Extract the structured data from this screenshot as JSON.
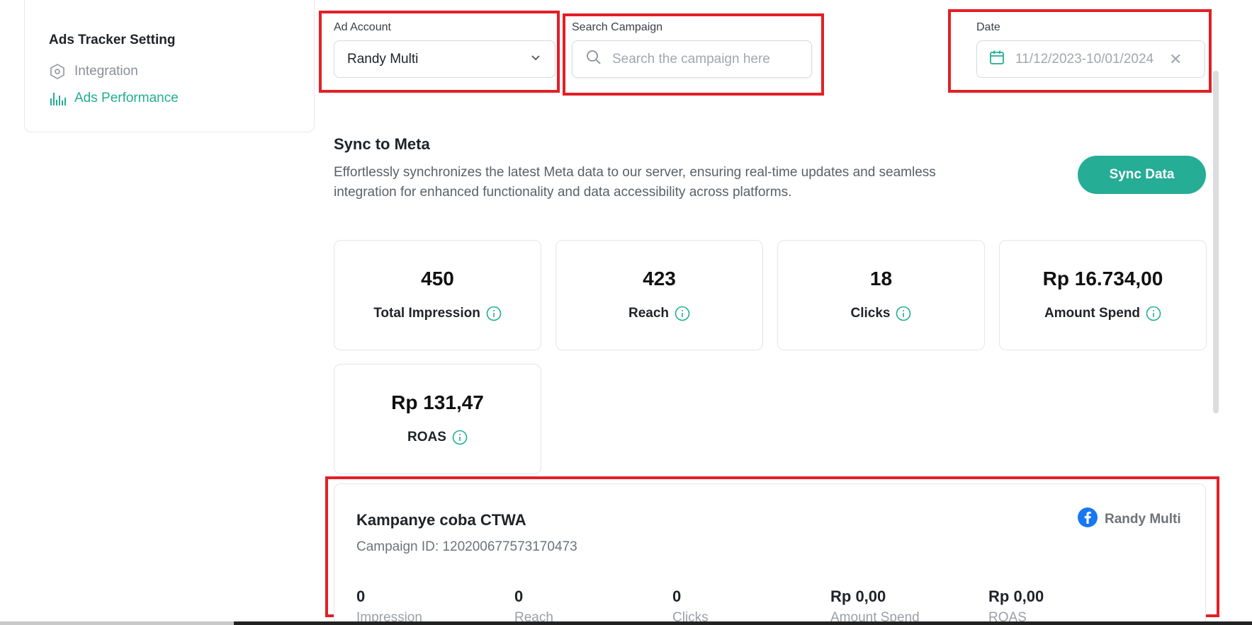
{
  "sidebar": {
    "title": "Ads Tracker Setting",
    "items": [
      {
        "label": "Integration",
        "icon": "hexagon-icon"
      },
      {
        "label": "Ads Performance",
        "icon": "bar-chart-icon"
      }
    ],
    "active_color": "#21ad93"
  },
  "filters": {
    "ad_account": {
      "label": "Ad Account",
      "value": "Randy Multi"
    },
    "search": {
      "label": "Search Campaign",
      "placeholder": "Search the campaign here"
    },
    "date": {
      "label": "Date",
      "value": "11/12/2023-10/01/2024"
    }
  },
  "sync": {
    "title": "Sync to Meta",
    "description": "Effortlessly synchronizes the latest Meta data to our server, ensuring real-time updates and seamless integration for enhanced functionality and data accessibility across platforms.",
    "button_label": "Sync Data",
    "button_color": "#25ad95"
  },
  "stats": [
    {
      "value": "450",
      "label": "Total Impression"
    },
    {
      "value": "423",
      "label": "Reach"
    },
    {
      "value": "18",
      "label": "Clicks"
    },
    {
      "value": "Rp 16.734,00",
      "label": "Amount Spend"
    },
    {
      "value": "Rp 131,47",
      "label": "ROAS"
    }
  ],
  "campaign": {
    "title": "Kampanye coba CTWA",
    "id_text": "Campaign ID: 120200677573170473",
    "account": "Randy Multi",
    "metrics": [
      {
        "value": "0",
        "label": "Impression"
      },
      {
        "value": "0",
        "label": "Reach"
      },
      {
        "value": "0",
        "label": "Clicks"
      },
      {
        "value": "Rp 0,00",
        "label": "Amount Spend"
      },
      {
        "value": "Rp 0,00",
        "label": "ROAS"
      }
    ]
  },
  "highlight_color": "#e31f26"
}
